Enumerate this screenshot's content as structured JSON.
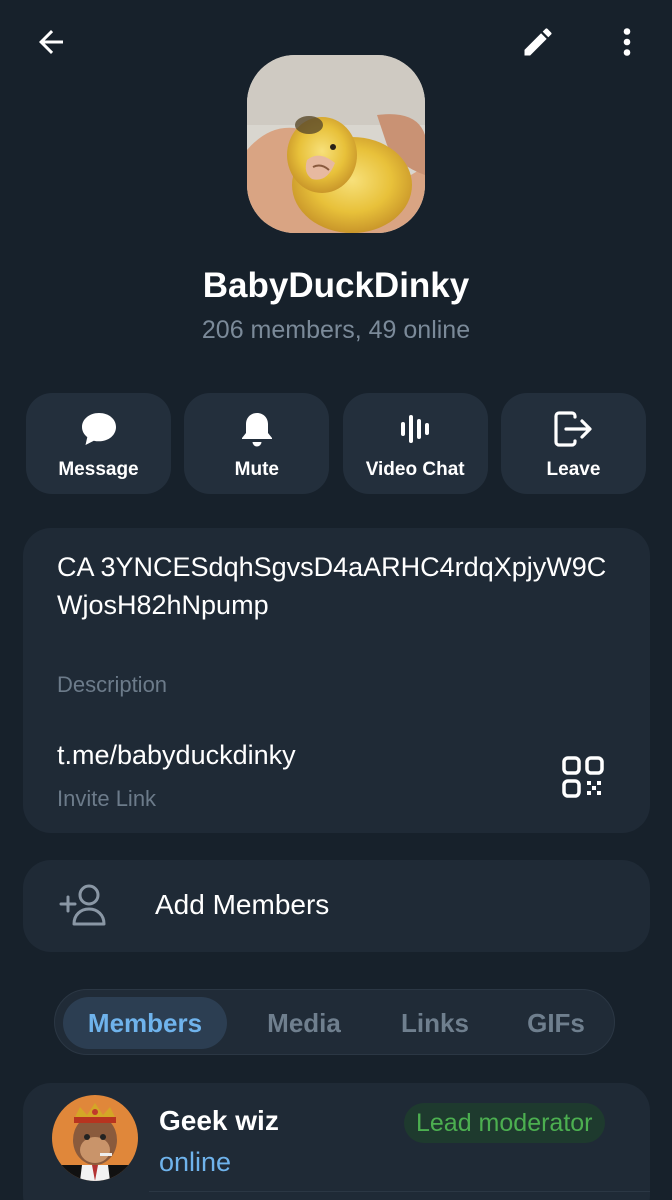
{
  "header": {
    "back_icon": "arrow-left-icon",
    "edit_icon": "pencil-icon",
    "more_icon": "more-vertical-icon"
  },
  "group": {
    "name": "BabyDuckDinky",
    "subtitle": "206 members, 49 online"
  },
  "actions": [
    {
      "label": "Message",
      "icon": "chat-bubble-icon"
    },
    {
      "label": "Mute",
      "icon": "bell-icon"
    },
    {
      "label": "Video Chat",
      "icon": "voice-wave-icon"
    },
    {
      "label": "Leave",
      "icon": "leave-icon"
    }
  ],
  "info": {
    "description": "CA 3YNCESdqhSgvsD4aARHC4rdqXpjyW9CWjosH82hNpump",
    "description_label": "Description",
    "invite_link": "t.me/babyduckdinky",
    "invite_link_label": "Invite Link"
  },
  "add_members": {
    "label": "Add Members"
  },
  "tabs": [
    {
      "label": "Members",
      "active": true
    },
    {
      "label": "Media",
      "active": false
    },
    {
      "label": "Links",
      "active": false
    },
    {
      "label": "GIFs",
      "active": false
    }
  ],
  "members": [
    {
      "name": "Geek wiz",
      "status": "online",
      "badge": "Lead moderator"
    }
  ],
  "colors": {
    "background": "#17212b",
    "card": "#1f2a36",
    "accent": "#6fb3ec",
    "badge_green": "#4caf50"
  }
}
